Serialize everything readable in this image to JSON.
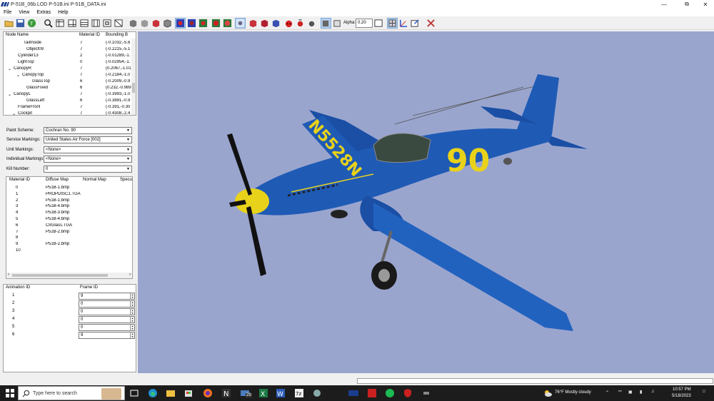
{
  "window": {
    "title": "P-51B_06b.LOD  P-51B.ini  P-51B_DATA.ini"
  },
  "menu": [
    "File",
    "View",
    "Extras",
    "Help"
  ],
  "toolbar": {
    "alpha_label": "Alpha:",
    "alpha_value": "0.20"
  },
  "node_tree": {
    "headers": [
      "Node Name",
      "Material ID",
      "Bounding B"
    ],
    "rows": [
      {
        "name": "TailInside",
        "mat": "7",
        "bbox": "(-0.1032,-5.6"
      },
      {
        "name": "Object09",
        "mat": "7",
        "bbox": "(-0.2215,-5.1"
      },
      {
        "name": "Cylinder13",
        "mat": "2",
        "bbox": "(-0.01289,-1."
      },
      {
        "name": "LightTop",
        "mat": "0",
        "bbox": "(-0.02954,-1."
      },
      {
        "name": "CanopyR",
        "mat": "7",
        "bbox": "(0.2067,-1.01"
      },
      {
        "name": "CanopyTop",
        "mat": "7",
        "bbox": "(-0.2184,-1.0"
      },
      {
        "name": "GlassTop",
        "mat": "6",
        "bbox": "(-0.2009,-0.9"
      },
      {
        "name": "GlassFixed",
        "mat": "6",
        "bbox": "(0.232,-0.989"
      },
      {
        "name": "CanopyL",
        "mat": "7",
        "bbox": "(-0.3993,-1.0"
      },
      {
        "name": "GlassLeft",
        "mat": "6",
        "bbox": "(-0.3891,-0.9"
      },
      {
        "name": "FrameFront",
        "mat": "7",
        "bbox": "(-0.391,-0.30"
      },
      {
        "name": "Cockpit",
        "mat": "7",
        "bbox": "(-0.4308,-2.4"
      }
    ]
  },
  "properties": {
    "paint_scheme": {
      "label": "Paint Scheme:",
      "value": "Cochran No. 90"
    },
    "service_markings": {
      "label": "Service Markings:",
      "value": "United States Air Force [002]"
    },
    "unit_markings": {
      "label": "Unit Markings:",
      "value": "<None>"
    },
    "individual_markings": {
      "label": "Individual Markings:",
      "value": "<None>"
    },
    "kill_number": {
      "label": "Kill Number:",
      "value": "0"
    }
  },
  "materials": {
    "headers": [
      "Material ID",
      "Diffuse Map",
      "Normal Map",
      "Specu"
    ],
    "rows": [
      {
        "id": "0",
        "diffuse": "P51B-1.bmp"
      },
      {
        "id": "1",
        "diffuse": "PROPDISC1.TGA"
      },
      {
        "id": "2",
        "diffuse": "P51B-1.bmp"
      },
      {
        "id": "3",
        "diffuse": "P51B-4.bmp"
      },
      {
        "id": "4",
        "diffuse": "P51B-3.bmp"
      },
      {
        "id": "5",
        "diffuse": "P51B-4.bmp"
      },
      {
        "id": "6",
        "diffuse": "ClrGlass.TGA"
      },
      {
        "id": "7",
        "diffuse": "P51B-2.bmp"
      },
      {
        "id": "8",
        "diffuse": ""
      },
      {
        "id": "9",
        "diffuse": "P51B-2.bmp"
      },
      {
        "id": "10",
        "diffuse": ""
      }
    ]
  },
  "animation": {
    "headers": [
      "Animation ID",
      "Frame ID"
    ],
    "rows": [
      {
        "id": "1",
        "frame": "9"
      },
      {
        "id": "2",
        "frame": "0"
      },
      {
        "id": "3",
        "frame": "0"
      },
      {
        "id": "4",
        "frame": "0"
      },
      {
        "id": "5",
        "frame": "0"
      },
      {
        "id": "6",
        "frame": "9"
      }
    ]
  },
  "viewport": {
    "registration": "N5528N",
    "race_number": "90",
    "fuselage_color": "#1f5bb5",
    "marking_color": "#e9d21a",
    "background": "#9aa5ce"
  },
  "taskbar": {
    "search_placeholder": "Type here to search",
    "weather": "76°F  Mostly cloudy",
    "time": "10:57 PM",
    "date": "5/18/2023",
    "badge": "29"
  }
}
